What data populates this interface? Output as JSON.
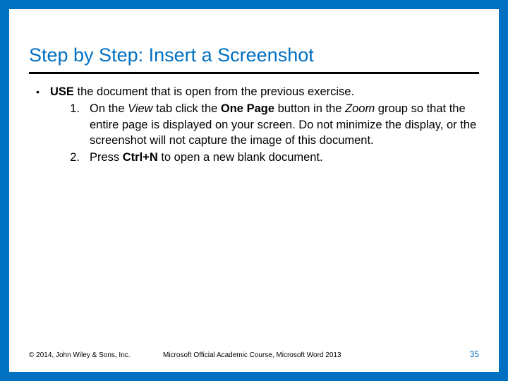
{
  "title": "Step by Step: Insert a Screenshot",
  "bullet": {
    "marker": "•",
    "lead_html": "<b>USE</b> the document that is open from the previous exercise."
  },
  "steps": [
    {
      "num": "1.",
      "html": "On the <i>View</i> tab click the <b>One Page</b> button in the <i>Zoom</i> group so that the entire page is displayed on your screen. Do not minimize the display, or the screenshot will not capture the image of this document."
    },
    {
      "num": "2.",
      "html": "Press <b>Ctrl+N</b> to open a new blank document."
    }
  ],
  "footer": {
    "copyright": "© 2014, John Wiley & Sons, Inc.",
    "course": "Microsoft Official Academic Course, Microsoft Word 2013",
    "page": "35"
  }
}
